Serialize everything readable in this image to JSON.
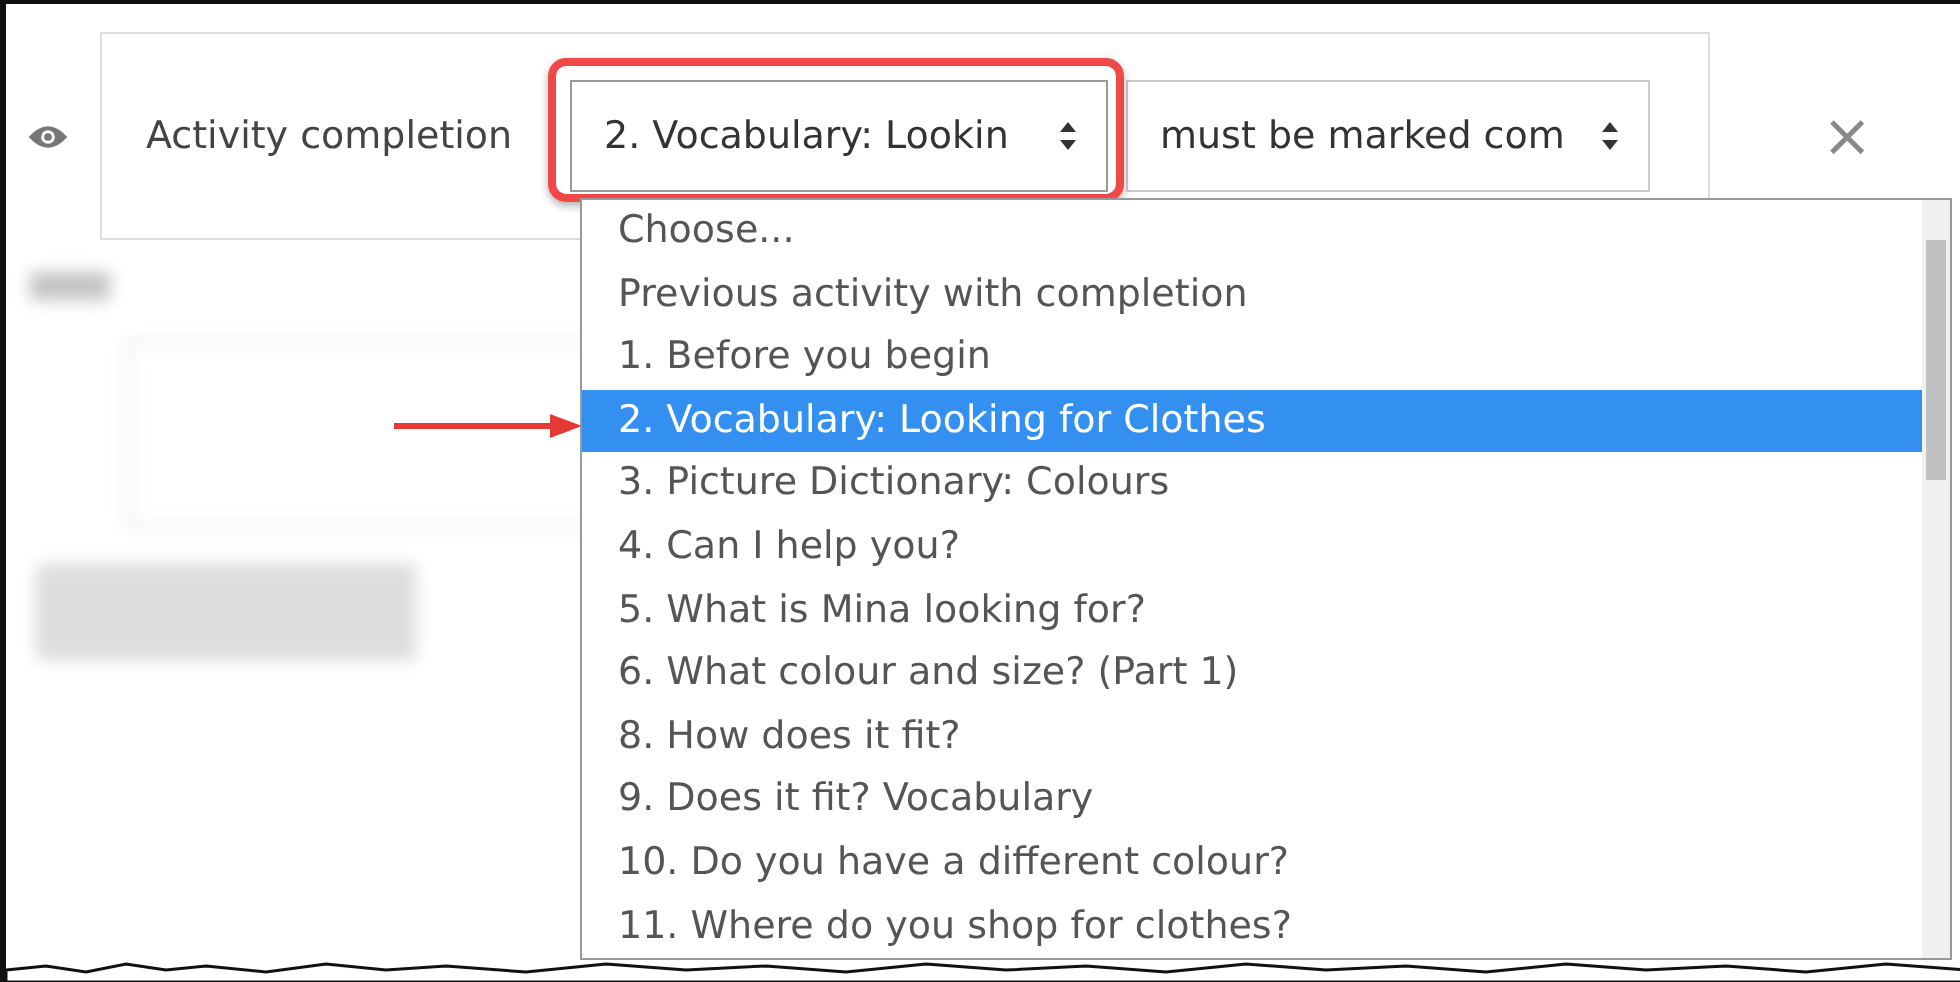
{
  "restriction": {
    "label": "Activity completion",
    "activity_select": {
      "value": "2. Vocabulary: Lookin",
      "highlighted": true
    },
    "condition_select": {
      "value": "must be marked com"
    },
    "delete_icon": "×"
  },
  "dropdown": {
    "options": [
      {
        "label": "Choose...",
        "selected": false
      },
      {
        "label": "Previous activity with completion",
        "selected": false
      },
      {
        "label": "1. Before you begin",
        "selected": false
      },
      {
        "label": "2. Vocabulary: Looking for Clothes",
        "selected": true
      },
      {
        "label": "3. Picture Dictionary: Colours",
        "selected": false
      },
      {
        "label": "4. Can I help you?",
        "selected": false
      },
      {
        "label": "5. What is Mina looking for?",
        "selected": false
      },
      {
        "label": "6. What colour and size? (Part 1)",
        "selected": false
      },
      {
        "label": "8. How does it fit?",
        "selected": false
      },
      {
        "label": "9. Does it fit? Vocabulary",
        "selected": false
      },
      {
        "label": "10. Do you have a different colour?",
        "selected": false
      },
      {
        "label": "11. Where do you shop for clothes?",
        "selected": false
      }
    ]
  }
}
